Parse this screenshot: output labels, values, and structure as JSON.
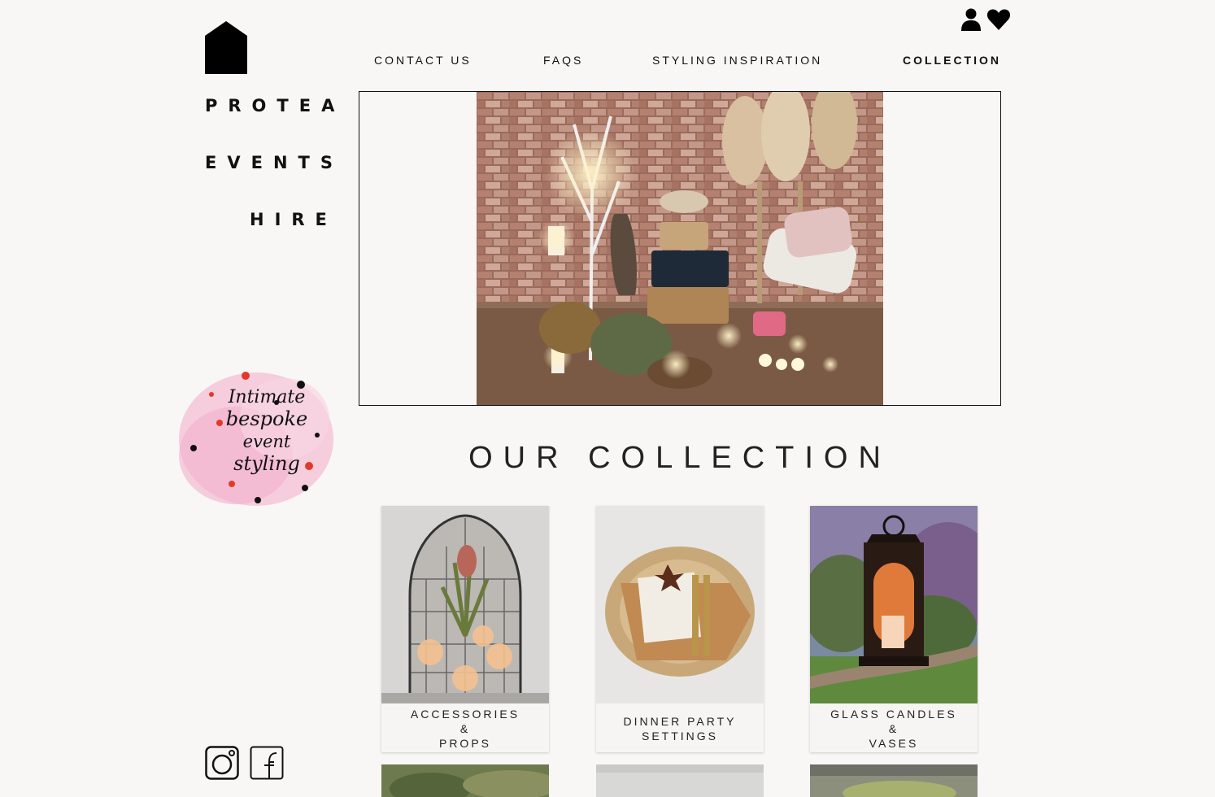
{
  "brand": {
    "line1": "PROTEA",
    "line2": "EVENTS",
    "line3": "HIRE"
  },
  "header": {
    "icons": [
      "user-icon",
      "heart-icon"
    ]
  },
  "nav": {
    "items": [
      {
        "label": "CONTACT US",
        "active": false
      },
      {
        "label": "FAQS",
        "active": false
      },
      {
        "label": "STYLING INSPIRATION",
        "active": false
      },
      {
        "label": "COLLECTION",
        "active": true
      }
    ]
  },
  "badge": {
    "lines": [
      "Intimate",
      "bespoke",
      "event",
      "styling"
    ]
  },
  "collection": {
    "title": "OUR COLLECTION",
    "cards": [
      {
        "label": "ACCESSORIES\n&\nPROPS"
      },
      {
        "label": "DINNER PARTY\nSETTINGS"
      },
      {
        "label": "GLASS CANDLES\n&\nVASES"
      }
    ]
  },
  "social": [
    "instagram-icon",
    "facebook-icon"
  ],
  "colors": {
    "background": "#f8f7f5",
    "text": "#111111",
    "badge_pink": "#f2b8cf"
  }
}
